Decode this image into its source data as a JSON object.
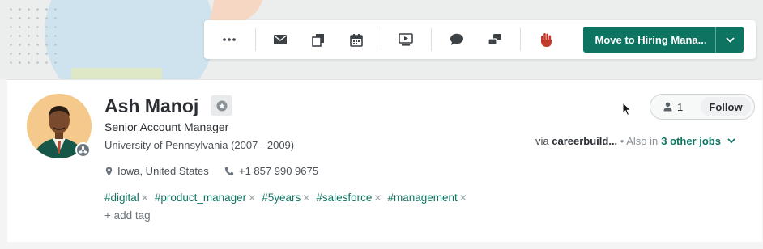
{
  "toolbar": {
    "buttons": [
      {
        "icon": "more-icon"
      },
      {
        "icon": "mail-icon"
      },
      {
        "icon": "copy-icon"
      },
      {
        "icon": "calendar-icon"
      },
      {
        "icon": "video-icon"
      },
      {
        "icon": "comment-icon"
      },
      {
        "icon": "share-icon"
      },
      {
        "icon": "hand-stop-icon"
      }
    ],
    "move_label": "Move to Hiring Mana...",
    "accent": "#0d7461"
  },
  "candidate": {
    "name": "Ash Manoj",
    "title": "Senior Account Manager",
    "education": "University of Pennsylvania (2007 - 2009)",
    "location": "Iowa, United States",
    "phone": "+1 857 990 9675",
    "tags": [
      "#digital",
      "#product_manager",
      "#5years",
      "#salesforce",
      "#management"
    ],
    "add_tag": "+ add tag"
  },
  "follow": {
    "count": "1",
    "label": "Follow"
  },
  "source": {
    "via": "via",
    "name": "careerbuild...",
    "also_in": "• Also in",
    "other_jobs": "3 other jobs"
  }
}
